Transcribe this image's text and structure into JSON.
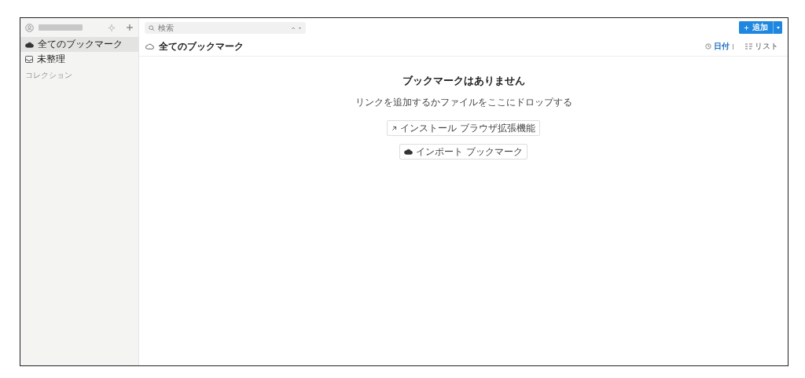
{
  "sidebar": {
    "items": [
      {
        "label": "全てのブックマーク",
        "selected": true,
        "kind": "cloud"
      },
      {
        "label": "未整理",
        "selected": false,
        "kind": "inbox"
      }
    ],
    "section": "コレクション"
  },
  "search": {
    "placeholder": "検索"
  },
  "add_button": {
    "label": "追加"
  },
  "header": {
    "title": "全てのブックマーク",
    "sort": "日付",
    "view": "リスト"
  },
  "empty": {
    "title": "ブックマークはありません",
    "subtitle": "リンクを追加するかファイルをここにドロップする",
    "buttons": [
      {
        "label": "インストール ブラウザ拡張機能",
        "kind": "external"
      },
      {
        "label": "インポート ブックマーク",
        "kind": "cloud"
      }
    ]
  }
}
